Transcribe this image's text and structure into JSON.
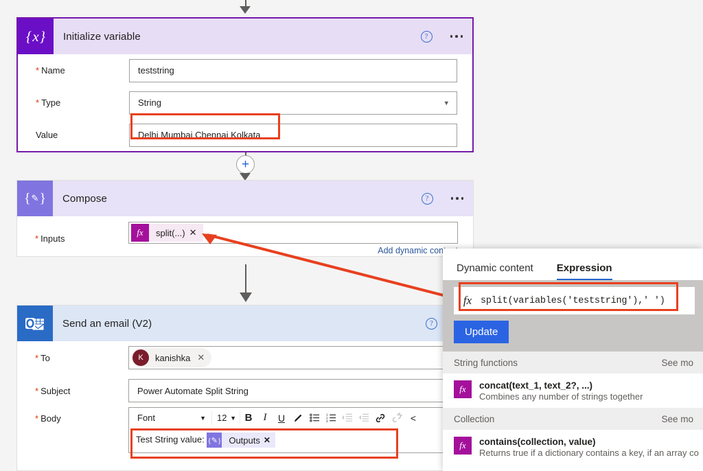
{
  "cards": {
    "initialize": {
      "title": "Initialize variable",
      "icon": "variable-icon",
      "fields": {
        "name_label": "Name",
        "name_value": "teststring",
        "type_label": "Type",
        "type_value": "String",
        "value_label": "Value",
        "value_value": "Delhi Mumbai Chennai Kolkata"
      }
    },
    "compose": {
      "title": "Compose",
      "icon": "compose-icon",
      "fields": {
        "inputs_label": "Inputs",
        "inputs_chip": "split(...)",
        "add_dynamic_content": "Add dynamic content"
      }
    },
    "email": {
      "title": "Send an email (V2)",
      "icon": "outlook-icon",
      "fields": {
        "to_label": "To",
        "to_person": "kanishka",
        "to_initial": "K",
        "subject_label": "Subject",
        "subject_value": "Power Automate Split String",
        "body_label": "Body",
        "body_text": "Test String value:",
        "body_token": "Outputs"
      },
      "toolbar": {
        "font_label": "Font",
        "size_label": "12",
        "bold": "B",
        "italic": "I",
        "underline": "U",
        "highlight": "pen-icon",
        "bullet_list": "bullet-list-icon",
        "numbered_list": "numbered-list-icon",
        "indent": "indent-icon",
        "outdent": "outdent-icon",
        "link": "link-icon",
        "unlink": "unlink-icon",
        "code": "code-icon"
      }
    }
  },
  "panel": {
    "tabs": [
      {
        "label": "Dynamic content",
        "active": false
      },
      {
        "label": "Expression",
        "active": true
      }
    ],
    "expression_value": "split(variables('teststring'),' ')",
    "update_label": "Update",
    "sections": [
      {
        "title": "String functions",
        "see_more": "See mo",
        "functions": [
          {
            "name": "concat(text_1, text_2?, ...)",
            "description": "Combines any number of strings together"
          }
        ]
      },
      {
        "title": "Collection",
        "see_more": "See mo",
        "functions": [
          {
            "name": "contains(collection, value)",
            "description": "Returns true if a dictionary contains a key, if an array co"
          }
        ]
      }
    ]
  },
  "icons": {
    "help": "?",
    "plus": "+",
    "chevron_down": "⌄",
    "close_x": "✕",
    "fx": "fx"
  },
  "colors": {
    "variable_purple": "#6b0fc7",
    "compose_purple": "#8075e0",
    "outlook_blue": "#2a6bc6",
    "expression_magenta": "#a4109b",
    "annotation_red": "#e8401f",
    "update_blue": "#2b64e3",
    "link_blue": "#2b579a"
  }
}
